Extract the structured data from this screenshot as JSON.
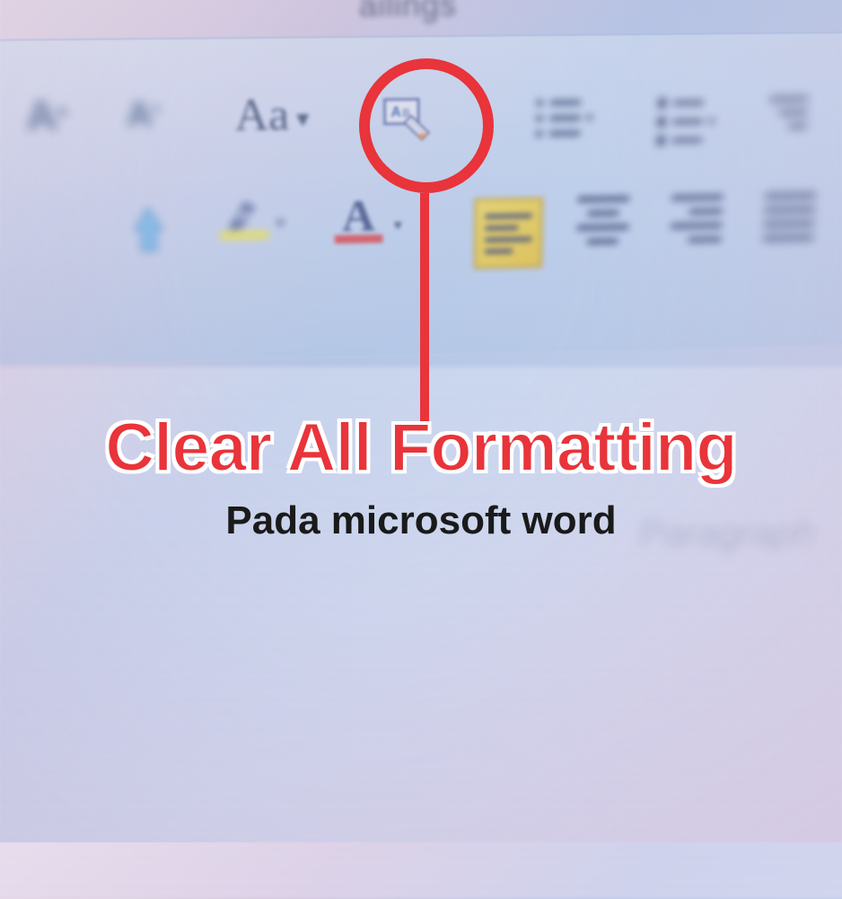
{
  "ribbon": {
    "tab_partial": "ailings",
    "group_label": "Paragraph",
    "row1": {
      "grow_font": "A",
      "shrink_font": "A",
      "change_case": "Aa",
      "clear_formatting_icon": "clear-formatting"
    },
    "row2": {
      "font_color_letter": "A",
      "highlight_letter": "ab"
    }
  },
  "annotation": {
    "title": "Clear All Formatting",
    "subtitle": "Pada microsoft word",
    "highlight_color": "#e8343a"
  }
}
